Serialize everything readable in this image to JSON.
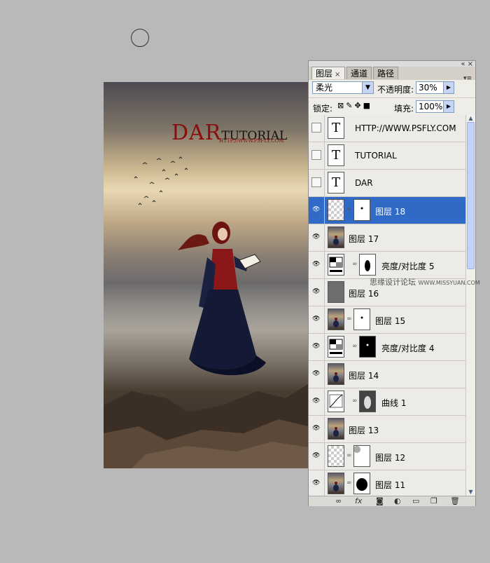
{
  "canvas": {
    "title_big": "DAR",
    "title_small": "TUTORIAL",
    "subtitle": "HTTP://WWW.PSFLY.COM"
  },
  "panel": {
    "tabs": [
      {
        "label": "图层",
        "active": true
      },
      {
        "label": "通道",
        "active": false
      },
      {
        "label": "路径",
        "active": false
      }
    ],
    "blend_mode": "柔光",
    "opacity_label": "不透明度:",
    "opacity_value": "30%",
    "lock_label": "锁定:",
    "fill_label": "填充:",
    "fill_value": "100%"
  },
  "layers": [
    {
      "name": "HTTP://WWW.PSFLY.COM",
      "thumb": "text",
      "visible": false,
      "mask": null,
      "selected": false
    },
    {
      "name": "TUTORIAL",
      "thumb": "text",
      "visible": false,
      "mask": null,
      "selected": false
    },
    {
      "name": "DAR",
      "thumb": "text",
      "visible": false,
      "mask": null,
      "selected": false
    },
    {
      "name": "图层 18",
      "thumb": "transparent",
      "visible": true,
      "mask": "white-dot",
      "selected": true
    },
    {
      "name": "图层 17",
      "thumb": "photo",
      "visible": true,
      "mask": null,
      "selected": false
    },
    {
      "name": "亮度/对比度 5",
      "thumb": "adjust",
      "visible": true,
      "mask": "white-figure",
      "selected": false
    },
    {
      "name": "图层 16",
      "thumb": "gray",
      "visible": true,
      "mask": null,
      "selected": false
    },
    {
      "name": "图层 15",
      "thumb": "photo",
      "visible": true,
      "mask": "white-dot",
      "selected": false
    },
    {
      "name": "亮度/对比度 4",
      "thumb": "adjust",
      "visible": true,
      "mask": "black-dot",
      "selected": false
    },
    {
      "name": "图层 14",
      "thumb": "photo",
      "visible": true,
      "mask": null,
      "selected": false
    },
    {
      "name": "曲线 1",
      "thumb": "curves",
      "visible": true,
      "mask": "gray-figure",
      "selected": false
    },
    {
      "name": "图层 13",
      "thumb": "photo",
      "visible": true,
      "mask": null,
      "selected": false
    },
    {
      "name": "图层 12",
      "thumb": "transparent",
      "visible": true,
      "mask": "white-corner",
      "selected": false
    },
    {
      "name": "图层 11",
      "thumb": "photo",
      "visible": true,
      "mask": "white-blob",
      "selected": false
    }
  ],
  "watermark": {
    "text": "思缘设计论坛",
    "url": "WWW.MISSYUAN.COM"
  },
  "icons": [
    "brush-cursor",
    "eye-icon",
    "chain-icon",
    "link-layers-icon",
    "fx-icon",
    "add-mask-icon",
    "adjustment-icon",
    "group-folder-icon",
    "new-layer-icon",
    "trash-icon"
  ],
  "colors": {
    "selection": "#3169c6",
    "title_red": "#8a0c0c",
    "panel_bg": "#d4d0c8"
  }
}
